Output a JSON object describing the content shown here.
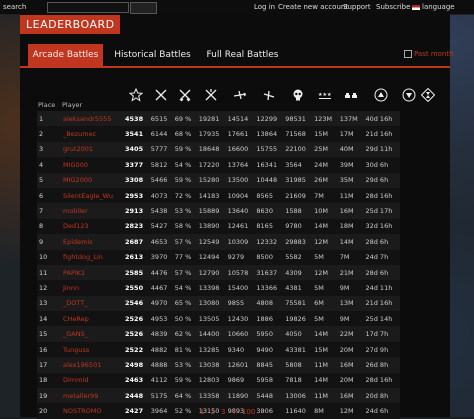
{
  "topbar": {
    "search_label": "search",
    "login": "Log in",
    "create_account": "Create new account",
    "support": "Support",
    "subscribe": "Subscribe",
    "language": "language"
  },
  "header": {
    "title": "LEADERBOARD"
  },
  "tabs": [
    {
      "label": "Arcade Battles",
      "active": true
    },
    {
      "label": "Historical Battles",
      "active": false
    },
    {
      "label": "Full Real Battles",
      "active": false
    }
  ],
  "filter": {
    "past_month_label": "Past month"
  },
  "table": {
    "headers": {
      "place": "Place",
      "player": "Player"
    },
    "icon_columns": [
      "rank-star-icon",
      "crossed-swords-icon",
      "crossed-swords-icon",
      "crossed-swords-icon",
      "bomber-plane-icon",
      "fighter-plane-icon",
      "skull-icon",
      "ground-stars-icon",
      "tanks-icon",
      "eagle-icon",
      "eagle-icon",
      "hourglass-icon"
    ],
    "rows": [
      [
        "1",
        "aleksandr5555",
        "4538",
        "6515",
        "69 %",
        "19281",
        "14514",
        "12299",
        "98531",
        "123M",
        "137M",
        "40d 16h"
      ],
      [
        "2",
        "_Bezumec",
        "3541",
        "6144",
        "68 %",
        "17935",
        "17661",
        "13864",
        "71568",
        "15M",
        "17M",
        "21d 16h"
      ],
      [
        "3",
        "grut2001",
        "3405",
        "5777",
        "59 %",
        "18648",
        "16600",
        "15755",
        "22100",
        "25M",
        "40M",
        "29d 11h"
      ],
      [
        "4",
        "MIG000",
        "3377",
        "5812",
        "54 %",
        "17220",
        "13764",
        "16341",
        "3564",
        "24M",
        "39M",
        "30d 6h"
      ],
      [
        "5",
        "MIG2000",
        "3308",
        "5466",
        "59 %",
        "15280",
        "13500",
        "10448",
        "31985",
        "26M",
        "35M",
        "29d 6h"
      ],
      [
        "6",
        "SilentEagle_Wu",
        "2953",
        "4073",
        "72 %",
        "14183",
        "10904",
        "8565",
        "21609",
        "7M",
        "11M",
        "28d 16h"
      ],
      [
        "7",
        "mobiler",
        "2913",
        "5438",
        "53 %",
        "15889",
        "13640",
        "8630",
        "1588",
        "10M",
        "16M",
        "25d 17h"
      ],
      [
        "8",
        "Ded123",
        "2823",
        "5427",
        "58 %",
        "13890",
        "12461",
        "8165",
        "9780",
        "14M",
        "18M",
        "32d 16h"
      ],
      [
        "9",
        "Epidemis",
        "2687",
        "4653",
        "57 %",
        "12549",
        "10309",
        "12332",
        "29883",
        "12M",
        "14M",
        "28d 6h"
      ],
      [
        "10",
        "fightdog_Lin",
        "2613",
        "3970",
        "77 %",
        "12494",
        "9279",
        "8500",
        "5582",
        "5M",
        "7M",
        "24d 7h"
      ],
      [
        "11",
        "PAPIK1",
        "2585",
        "4476",
        "57 %",
        "12790",
        "10578",
        "31637",
        "4309",
        "12M",
        "21M",
        "28d 6h"
      ],
      [
        "12",
        "Jinnn",
        "2550",
        "4467",
        "54 %",
        "13398",
        "15400",
        "13366",
        "4381",
        "5M",
        "9M",
        "24d 11h"
      ],
      [
        "13",
        "_DOTT_",
        "2546",
        "4970",
        "65 %",
        "13080",
        "9855",
        "4808",
        "75581",
        "6M",
        "13M",
        "21d 16h"
      ],
      [
        "14",
        "CHeRep",
        "2526",
        "4953",
        "50 %",
        "13505",
        "12430",
        "1886",
        "19826",
        "5M",
        "9M",
        "25d 14h"
      ],
      [
        "15",
        "_GANS_",
        "2526",
        "4839",
        "62 %",
        "14400",
        "10660",
        "5950",
        "4050",
        "14M",
        "22M",
        "17d 7h"
      ],
      [
        "16",
        "Tunguss",
        "2522",
        "4882",
        "81 %",
        "13285",
        "9340",
        "9490",
        "43381",
        "15M",
        "20M",
        "27d 9h"
      ],
      [
        "17",
        "alex196501",
        "2498",
        "4888",
        "53 %",
        "13038",
        "12601",
        "8845",
        "5808",
        "11M",
        "16M",
        "26d 8h"
      ],
      [
        "18",
        "Dimmid",
        "2463",
        "4112",
        "59 %",
        "12803",
        "9869",
        "5958",
        "7818",
        "14M",
        "20M",
        "28d 16h"
      ],
      [
        "19",
        "metaller99",
        "2448",
        "5175",
        "64 %",
        "13358",
        "11890",
        "5448",
        "13006",
        "11M",
        "16M",
        "20d 8h"
      ],
      [
        "20",
        "NOSTROMO",
        "2427",
        "3964",
        "52 %",
        "13150",
        "9893",
        "3806",
        "11640",
        "8M",
        "12M",
        "24d 6h"
      ]
    ]
  },
  "pagination": {
    "pages": [
      "1",
      "2",
      "3",
      "4"
    ],
    "last": "100",
    "next": "›"
  },
  "colors": {
    "accent": "#c0361e",
    "panel": "#0c0c0c"
  }
}
